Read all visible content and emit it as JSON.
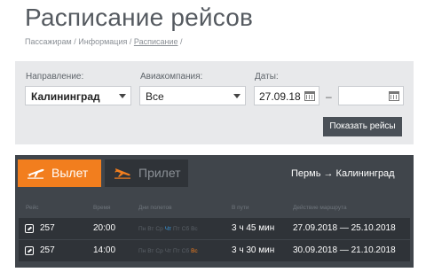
{
  "page": {
    "title": "Расписание рейсов",
    "breadcrumb": [
      "Пассажирам",
      "Информация",
      "Расписание"
    ],
    "breadcrumb_separator": " / "
  },
  "filters": {
    "direction_label": "Направление:",
    "direction_value": "Калининград",
    "airline_label": "Авиакомпания:",
    "airline_value": "Все",
    "dates_label": "Даты:",
    "date_from": "27.09.18",
    "date_to": "",
    "date_separator": "–",
    "show_button": "Показать рейсы"
  },
  "tabs": {
    "departure": "Вылет",
    "arrival": "Прилет",
    "active": "departure"
  },
  "route": "Пермь → Калининград",
  "table": {
    "columns": [
      "Рейс",
      "Время",
      "Дни полетов",
      "В пути",
      "Действие маршрута"
    ],
    "rows": [
      {
        "flight": "257",
        "time": "20:00",
        "days": [
          "Пн",
          "Вт",
          "Ср",
          "Чт",
          "Пт",
          "Сб",
          "Вс"
        ],
        "active_days": [
          "Чт"
        ],
        "duration": "3 ч 45 мин",
        "validity": "27.09.2018 — 25.10.2018"
      },
      {
        "flight": "257",
        "time": "14:00",
        "days": [
          "Пн",
          "Вт",
          "Ср",
          "Чт",
          "Пт",
          "Сб",
          "Вс"
        ],
        "active_days": [
          "Вс"
        ],
        "duration": "3 ч 30 мин",
        "validity": "30.09.2018 — 21.10.2018"
      }
    ]
  },
  "colors": {
    "accent": "#f27e1e",
    "panel_dark": "#40454b",
    "row_dark": "#2f3338",
    "filter_bg": "#e8e9eb",
    "active_day_blue": "#3aa0e8"
  }
}
